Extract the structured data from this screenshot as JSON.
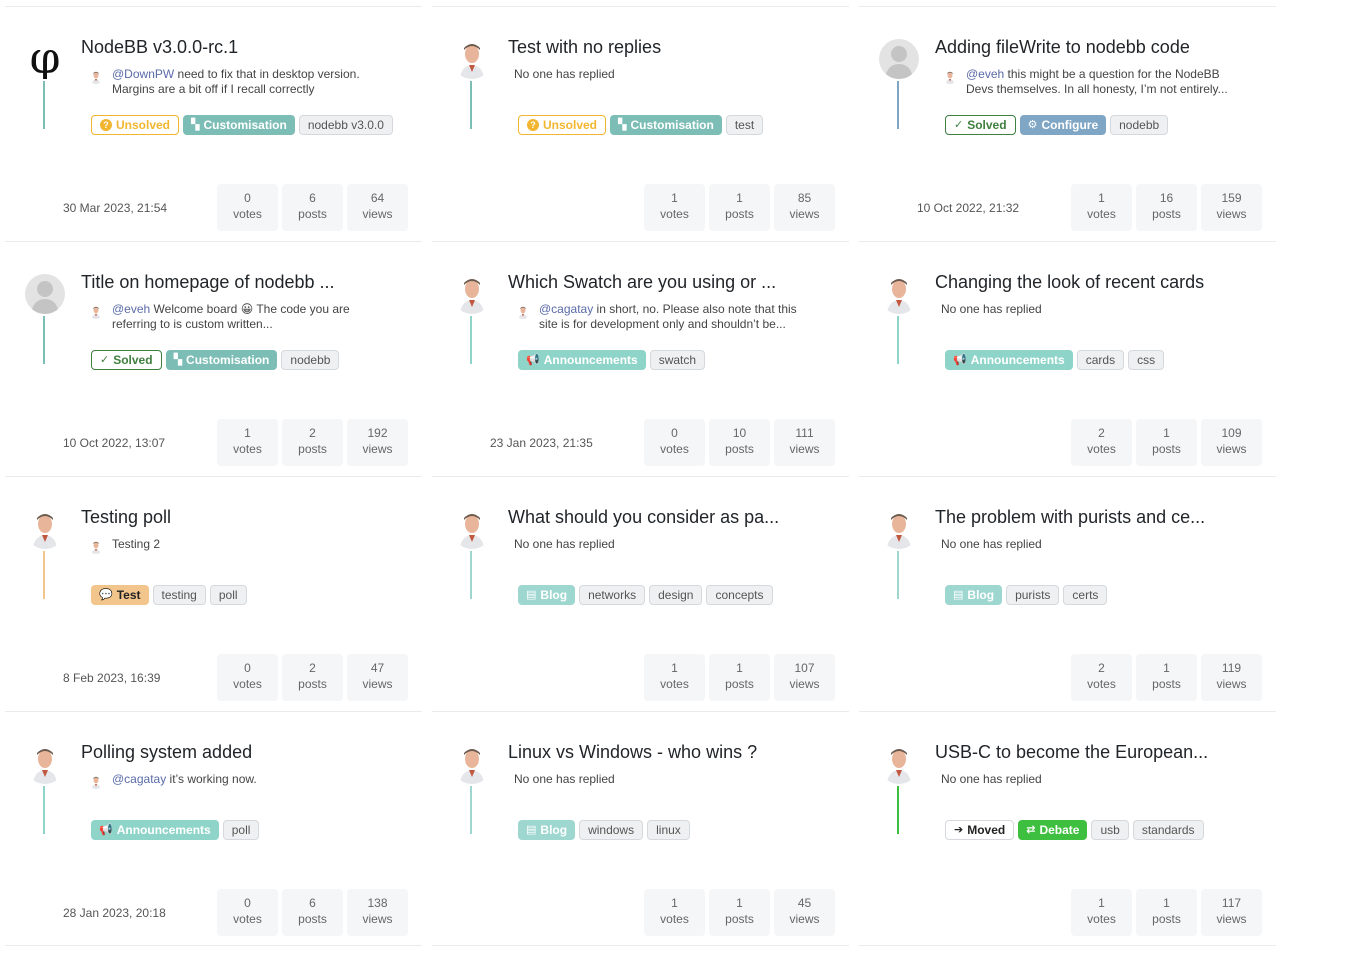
{
  "colors": {
    "customisation": "#7cbdb6",
    "configure": "#7fa6c4",
    "announcements": "#8fd4c9",
    "blog": "#9ed6d0",
    "test": "#f2c58d",
    "debate": "#3fbf3f",
    "unsolved": "#f2b530",
    "solved": "#3f7f3f"
  },
  "topics": [
    {
      "title": "NodeBB v3.0.0-rc.1",
      "avatar": "logo-icon",
      "line_color": "#7cbdb6",
      "teaser_user": "@DownPW",
      "teaser_text": " need to fix that in desktop version. Margins are a bit off if I recall correctly",
      "tags": [
        {
          "kind": "status",
          "label": "Unsolved",
          "icon": "?",
          "color": "#f2b530"
        },
        {
          "kind": "cat",
          "label": "Customisation",
          "icon": "▚",
          "color": "#7cbdb6"
        },
        {
          "kind": "plain",
          "label": "nodebb v3.0.0"
        }
      ],
      "date": "30 Mar 2023, 21:54",
      "votes": "0",
      "posts": "6",
      "views": "64"
    },
    {
      "title": "Test with no replies",
      "avatar": "person-avatar",
      "line_color": "#7cbdb6",
      "teaser_text": "No one has replied",
      "tags": [
        {
          "kind": "status",
          "label": "Unsolved",
          "icon": "?",
          "color": "#f2b530"
        },
        {
          "kind": "cat",
          "label": "Customisation",
          "icon": "▚",
          "color": "#7cbdb6"
        },
        {
          "kind": "plain",
          "label": "test"
        }
      ],
      "date": "",
      "votes": "1",
      "posts": "1",
      "views": "85"
    },
    {
      "title": "Adding fileWrite to nodebb code",
      "avatar": "default-avatar",
      "line_color": "#7fa6c4",
      "teaser_user": "@eveh",
      "teaser_text": " this might be a question for the NodeBB Devs themselves. In all honesty, I’m not entirely...",
      "tags": [
        {
          "kind": "status",
          "label": "Solved",
          "icon": "✓",
          "color": "#3f7f3f"
        },
        {
          "kind": "cat",
          "label": "Configure",
          "icon": "⚙",
          "color": "#7fa6c4"
        },
        {
          "kind": "plain",
          "label": "nodebb"
        }
      ],
      "date": "10 Oct 2022, 21:32",
      "votes": "1",
      "posts": "16",
      "views": "159"
    },
    {
      "title": "Title on homepage of nodebb ...",
      "avatar": "default-avatar",
      "line_color": "#7cbdb6",
      "teaser_user": "@eveh",
      "teaser_text": " Welcome board 😀 The code you are referring to is custom written...",
      "tags": [
        {
          "kind": "status",
          "label": "Solved",
          "icon": "✓",
          "color": "#3f7f3f"
        },
        {
          "kind": "cat",
          "label": "Customisation",
          "icon": "▚",
          "color": "#7cbdb6"
        },
        {
          "kind": "plain",
          "label": "nodebb"
        }
      ],
      "date": "10 Oct 2022, 13:07",
      "votes": "1",
      "posts": "2",
      "views": "192"
    },
    {
      "title": "Which Swatch are you using or ...",
      "avatar": "person-avatar",
      "line_color": "#8fd4c9",
      "teaser_user": "@cagatay",
      "teaser_text": " in short, no. Please also note that this site is for development only and shouldn’t be...",
      "tags": [
        {
          "kind": "cat",
          "label": "Announcements",
          "icon": "📢",
          "color": "#8fd4c9"
        },
        {
          "kind": "plain",
          "label": "swatch"
        }
      ],
      "date": "23 Jan 2023, 21:35",
      "votes": "0",
      "posts": "10",
      "views": "111"
    },
    {
      "title": "Changing the look of recent cards",
      "avatar": "person-avatar",
      "line_color": "#8fd4c9",
      "teaser_text": "No one has replied",
      "tags": [
        {
          "kind": "cat",
          "label": "Announcements",
          "icon": "📢",
          "color": "#8fd4c9"
        },
        {
          "kind": "plain",
          "label": "cards"
        },
        {
          "kind": "plain",
          "label": "css"
        }
      ],
      "date": "",
      "votes": "2",
      "posts": "1",
      "views": "109"
    },
    {
      "title": "Testing poll",
      "avatar": "person-avatar",
      "line_color": "#f2c58d",
      "teaser_text": "Testing 2",
      "teaser_has_avatar": true,
      "tags": [
        {
          "kind": "cat",
          "label": "Test",
          "icon": "💬",
          "color": "#f2c58d",
          "dark": true
        },
        {
          "kind": "plain",
          "label": "testing"
        },
        {
          "kind": "plain",
          "label": "poll"
        }
      ],
      "date": "8 Feb 2023, 16:39",
      "votes": "0",
      "posts": "2",
      "views": "47"
    },
    {
      "title": "What should you consider as pa...",
      "avatar": "person-avatar",
      "line_color": "#9ed6d0",
      "teaser_text": "No one has replied",
      "tags": [
        {
          "kind": "cat",
          "label": "Blog",
          "icon": "▤",
          "color": "#9ed6d0"
        },
        {
          "kind": "plain",
          "label": "networks"
        },
        {
          "kind": "plain",
          "label": "design"
        },
        {
          "kind": "plain",
          "label": "concepts"
        }
      ],
      "date": "",
      "votes": "1",
      "posts": "1",
      "views": "107"
    },
    {
      "title": "The problem with purists and ce...",
      "avatar": "person-avatar",
      "line_color": "#9ed6d0",
      "teaser_text": "No one has replied",
      "tags": [
        {
          "kind": "cat",
          "label": "Blog",
          "icon": "▤",
          "color": "#9ed6d0"
        },
        {
          "kind": "plain",
          "label": "purists"
        },
        {
          "kind": "plain",
          "label": "certs"
        }
      ],
      "date": "",
      "votes": "2",
      "posts": "1",
      "views": "119"
    },
    {
      "title": "Polling system added",
      "avatar": "person-avatar",
      "line_color": "#8fd4c9",
      "teaser_user": "@cagatay",
      "teaser_text": " it’s working now.",
      "tags": [
        {
          "kind": "cat",
          "label": "Announcements",
          "icon": "📢",
          "color": "#8fd4c9"
        },
        {
          "kind": "plain",
          "label": "poll"
        }
      ],
      "date": "28 Jan 2023, 20:18",
      "votes": "0",
      "posts": "6",
      "views": "138"
    },
    {
      "title": "Linux vs Windows - who wins ?",
      "avatar": "person-avatar",
      "line_color": "#9ed6d0",
      "teaser_text": "No one has replied",
      "tags": [
        {
          "kind": "cat",
          "label": "Blog",
          "icon": "▤",
          "color": "#9ed6d0"
        },
        {
          "kind": "plain",
          "label": "windows"
        },
        {
          "kind": "plain",
          "label": "linux"
        }
      ],
      "date": "",
      "votes": "1",
      "posts": "1",
      "views": "45"
    },
    {
      "title": "USB-C to become the European...",
      "avatar": "person-avatar",
      "line_color": "#3fbf3f",
      "teaser_text": "No one has replied",
      "tags": [
        {
          "kind": "moved",
          "label": "Moved",
          "icon": "➔"
        },
        {
          "kind": "cat",
          "label": "Debate",
          "icon": "⇄",
          "color": "#3fbf3f"
        },
        {
          "kind": "plain",
          "label": "usb"
        },
        {
          "kind": "plain",
          "label": "standards"
        }
      ],
      "date": "",
      "votes": "1",
      "posts": "1",
      "views": "117"
    }
  ],
  "labels": {
    "votes": "votes",
    "posts": "posts",
    "views": "views"
  }
}
